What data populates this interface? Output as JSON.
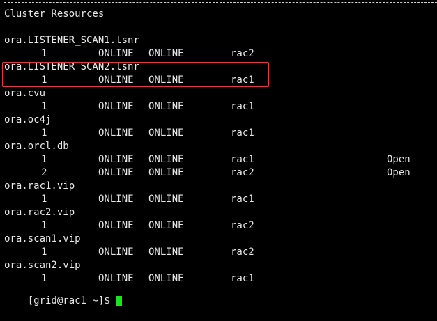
{
  "terminal": {
    "section_title": "Cluster Resources",
    "cursor_color": "#19e619",
    "highlight_color": "#e03a3a",
    "resources": [
      {
        "name": "ora.LISTENER_SCAN1.lsnr",
        "instances": [
          {
            "num": "1",
            "target": "ONLINE",
            "state": "ONLINE",
            "server": "rac2",
            "details": ""
          }
        ]
      },
      {
        "name": "ora.LISTENER_SCAN2.lsnr",
        "highlighted": true,
        "instances": [
          {
            "num": "1",
            "target": "ONLINE",
            "state": "ONLINE",
            "server": "rac1",
            "details": ""
          }
        ]
      },
      {
        "name": "ora.cvu",
        "instances": [
          {
            "num": "1",
            "target": "ONLINE",
            "state": "ONLINE",
            "server": "rac1",
            "details": ""
          }
        ]
      },
      {
        "name": "ora.oc4j",
        "instances": [
          {
            "num": "1",
            "target": "ONLINE",
            "state": "ONLINE",
            "server": "rac1",
            "details": ""
          }
        ]
      },
      {
        "name": "ora.orcl.db",
        "instances": [
          {
            "num": "1",
            "target": "ONLINE",
            "state": "ONLINE",
            "server": "rac1",
            "details": "Open"
          },
          {
            "num": "2",
            "target": "ONLINE",
            "state": "ONLINE",
            "server": "rac2",
            "details": "Open"
          }
        ]
      },
      {
        "name": "ora.rac1.vip",
        "instances": [
          {
            "num": "1",
            "target": "ONLINE",
            "state": "ONLINE",
            "server": "rac1",
            "details": ""
          }
        ]
      },
      {
        "name": "ora.rac2.vip",
        "instances": [
          {
            "num": "1",
            "target": "ONLINE",
            "state": "ONLINE",
            "server": "rac2",
            "details": ""
          }
        ]
      },
      {
        "name": "ora.scan1.vip",
        "instances": [
          {
            "num": "1",
            "target": "ONLINE",
            "state": "ONLINE",
            "server": "rac2",
            "details": ""
          }
        ]
      },
      {
        "name": "ora.scan2.vip",
        "instances": [
          {
            "num": "1",
            "target": "ONLINE",
            "state": "ONLINE",
            "server": "rac1",
            "details": ""
          }
        ]
      }
    ],
    "prompt": "[grid@rac1 ~]$ "
  }
}
